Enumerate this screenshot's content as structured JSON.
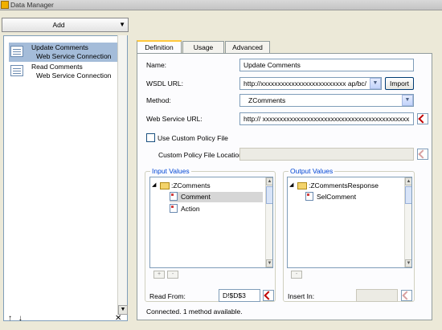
{
  "window": {
    "title": "Data Manager"
  },
  "add_button": {
    "label": "Add"
  },
  "connections": [
    {
      "name": "Update Comments",
      "type": "Web Service Connection"
    },
    {
      "name": "Read Comments",
      "type": "Web Service Connection"
    }
  ],
  "tabs": [
    "Definition",
    "Usage",
    "Advanced"
  ],
  "form": {
    "name_label": "Name:",
    "name_value": "Update Comments",
    "wsdl_label": "WSDL URL:",
    "wsdl_value": "http://xxxxxxxxxxxxxxxxxxxxxxxxx  ap/bc/",
    "import_label": "Import",
    "method_label": "Method:",
    "method_value": "ZComments",
    "ws_url_label": "Web Service URL:",
    "ws_url_value": "http://  xxxxxxxxxxxxxxxxxxxxxxxxxxxxxxxxxxxxxxxxxxx",
    "policy_label": "Use Custom Policy File",
    "policy_loc_label": "Custom Policy File Location:",
    "policy_loc_value": ""
  },
  "input_values": {
    "title": "Input Values",
    "root": ":ZComments",
    "children": [
      "Comment",
      "Action"
    ],
    "read_from_label": "Read From:",
    "read_from_value": "D!$D$3"
  },
  "output_values": {
    "title": "Output Values",
    "root": ":ZCommentsResponse",
    "children": [
      "SelComment"
    ],
    "insert_in_label": "Insert In:",
    "insert_in_value": ""
  },
  "status": "Connected. 1 method available.",
  "glyphs": {
    "dropdown": "▼",
    "collapse": "◢",
    "up": "▲",
    "down": "▼",
    "plus": "+",
    "minus": "-",
    "move_up": "↑",
    "move_down": "↓",
    "delete": "✕"
  },
  "colors": {
    "accent_tab": "#ffc83c",
    "selection": "#a4bcd9",
    "group_legend": "#0046d5"
  }
}
